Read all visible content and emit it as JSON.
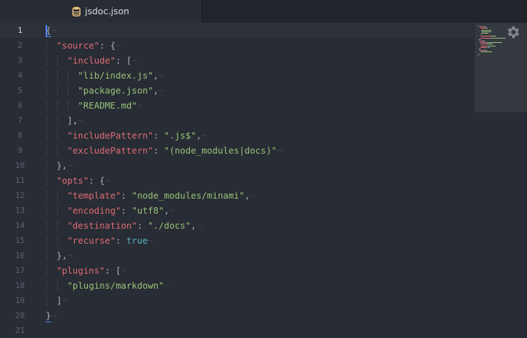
{
  "tab": {
    "title": "jsdoc.json",
    "icon": "json-database-icon"
  },
  "editor": {
    "active_line": 1,
    "line_numbers": [
      "1",
      "2",
      "3",
      "4",
      "5",
      "6",
      "7",
      "8",
      "9",
      "10",
      "11",
      "12",
      "13",
      "14",
      "15",
      "16",
      "17",
      "18",
      "19",
      "20",
      "21"
    ],
    "lines": [
      {
        "indent": 0,
        "tokens": [
          {
            "t": "p",
            "v": "{"
          }
        ]
      },
      {
        "indent": 1,
        "tokens": [
          {
            "t": "k",
            "v": "\"source\""
          },
          {
            "t": "p",
            "v": ": {"
          }
        ]
      },
      {
        "indent": 2,
        "tokens": [
          {
            "t": "k",
            "v": "\"include\""
          },
          {
            "t": "p",
            "v": ": ["
          }
        ]
      },
      {
        "indent": 3,
        "tokens": [
          {
            "t": "s",
            "v": "\"lib/index.js\""
          },
          {
            "t": "p",
            "v": ","
          }
        ]
      },
      {
        "indent": 3,
        "tokens": [
          {
            "t": "s",
            "v": "\"package.json\""
          },
          {
            "t": "p",
            "v": ","
          }
        ]
      },
      {
        "indent": 3,
        "tokens": [
          {
            "t": "s",
            "v": "\"README.md\""
          }
        ]
      },
      {
        "indent": 2,
        "tokens": [
          {
            "t": "p",
            "v": "],"
          }
        ]
      },
      {
        "indent": 2,
        "tokens": [
          {
            "t": "k",
            "v": "\"includePattern\""
          },
          {
            "t": "p",
            "v": ": "
          },
          {
            "t": "s",
            "v": "\".js$\""
          },
          {
            "t": "p",
            "v": ","
          }
        ]
      },
      {
        "indent": 2,
        "tokens": [
          {
            "t": "k",
            "v": "\"excludePattern\""
          },
          {
            "t": "p",
            "v": ": "
          },
          {
            "t": "s",
            "v": "\"(node_modules|docs)\""
          }
        ]
      },
      {
        "indent": 1,
        "tokens": [
          {
            "t": "p",
            "v": "},"
          }
        ]
      },
      {
        "indent": 1,
        "tokens": [
          {
            "t": "k",
            "v": "\"opts\""
          },
          {
            "t": "p",
            "v": ": {"
          }
        ]
      },
      {
        "indent": 2,
        "tokens": [
          {
            "t": "k",
            "v": "\"template\""
          },
          {
            "t": "p",
            "v": ": "
          },
          {
            "t": "s",
            "v": "\"node_modules/minami\""
          },
          {
            "t": "p",
            "v": ","
          }
        ]
      },
      {
        "indent": 2,
        "tokens": [
          {
            "t": "k",
            "v": "\"encoding\""
          },
          {
            "t": "p",
            "v": ": "
          },
          {
            "t": "s",
            "v": "\"utf8\""
          },
          {
            "t": "p",
            "v": ","
          }
        ]
      },
      {
        "indent": 2,
        "tokens": [
          {
            "t": "k",
            "v": "\"destination\""
          },
          {
            "t": "p",
            "v": ": "
          },
          {
            "t": "s",
            "v": "\"./docs\""
          },
          {
            "t": "p",
            "v": ","
          }
        ]
      },
      {
        "indent": 2,
        "tokens": [
          {
            "t": "k",
            "v": "\"recurse\""
          },
          {
            "t": "p",
            "v": ": "
          },
          {
            "t": "c",
            "v": "true"
          }
        ]
      },
      {
        "indent": 1,
        "tokens": [
          {
            "t": "p",
            "v": "},"
          }
        ]
      },
      {
        "indent": 1,
        "tokens": [
          {
            "t": "k",
            "v": "\"plugins\""
          },
          {
            "t": "p",
            "v": ": ["
          }
        ]
      },
      {
        "indent": 2,
        "tokens": [
          {
            "t": "s",
            "v": "\"plugins/markdown\""
          }
        ]
      },
      {
        "indent": 1,
        "tokens": [
          {
            "t": "p",
            "v": "]"
          }
        ]
      },
      {
        "indent": 0,
        "tokens": [
          {
            "t": "p",
            "v": "}"
          }
        ]
      },
      {
        "indent": 0,
        "tokens": []
      }
    ],
    "invisible_eol": "¬"
  },
  "minimap": {
    "icon": "gear-icon"
  },
  "colors": {
    "background": "#282c34",
    "tabbar": "#21252b",
    "key": "#e06c75",
    "string": "#98c379",
    "constant": "#56b6c2",
    "punctuation": "#abb2bf",
    "gutter_text": "#5c6370",
    "caret": "#528bff"
  }
}
